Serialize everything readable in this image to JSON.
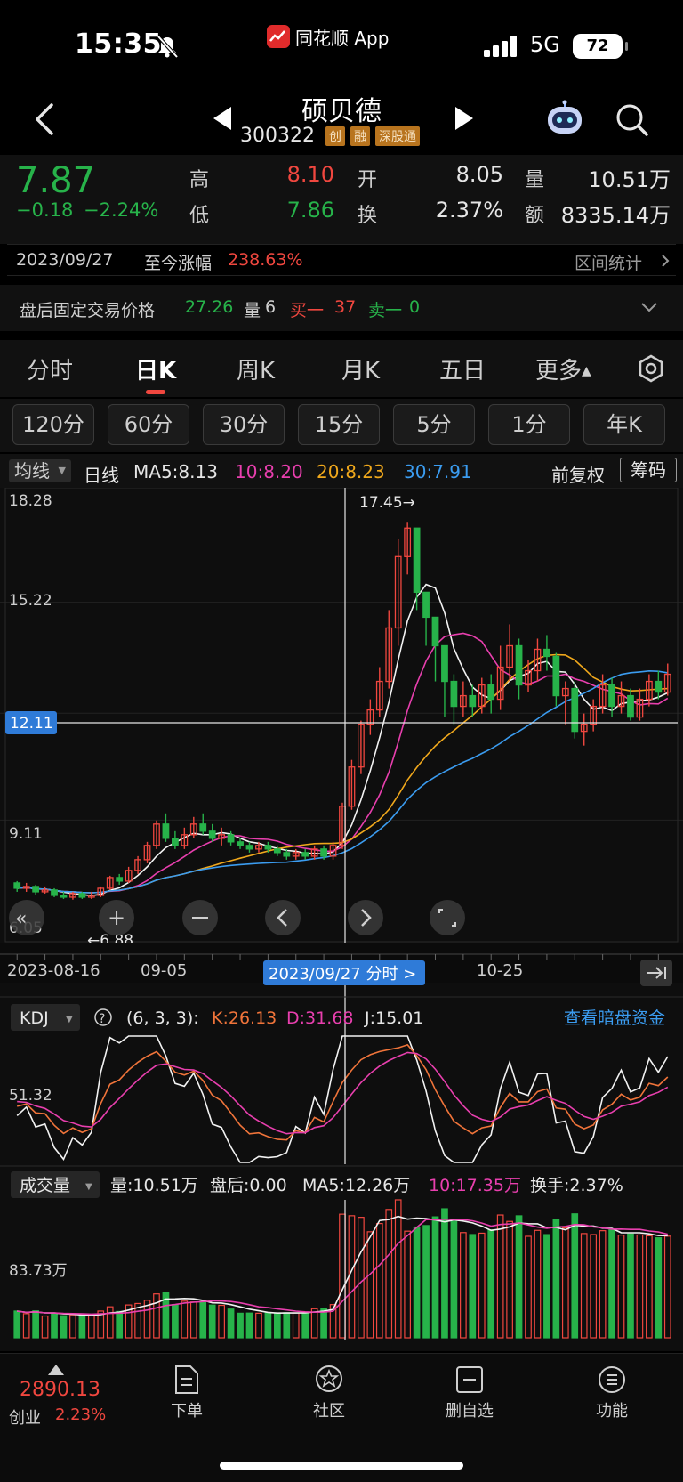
{
  "status_bar": {
    "time": "15:35",
    "app_name": "同花顺 App",
    "network": "5G",
    "battery": "72"
  },
  "header": {
    "stock_name": "硕贝德",
    "stock_code": "300322",
    "tags": [
      "创",
      "融",
      "深股通"
    ]
  },
  "quote": {
    "price": "7.87",
    "change": "−0.18",
    "change_pct": "−2.24%",
    "high_label": "高",
    "high": "8.10",
    "low_label": "低",
    "low": "7.86",
    "open_label": "开",
    "open": "8.05",
    "turnover_label": "换",
    "turnover": "2.37%",
    "volume_label": "量",
    "volume": "10.51万",
    "amount_label": "额",
    "amount": "8335.14万",
    "colors": {
      "up": "#f0473f",
      "down": "#27b34a"
    }
  },
  "range_stat": {
    "date": "2023/09/27",
    "label": "至今涨幅",
    "value": "238.63%",
    "link": "区间统计"
  },
  "after_hours": {
    "label": "盘后固定交易价格",
    "price": "27.26",
    "vol_label": "量",
    "vol": "6",
    "buy_label": "买一",
    "buy": "37",
    "sell_label": "卖一",
    "sell": "0"
  },
  "period_tabs": [
    "分时",
    "日K",
    "周K",
    "月K",
    "五日",
    "更多"
  ],
  "active_period": "日K",
  "minute_tabs": [
    "120分",
    "60分",
    "30分",
    "15分",
    "5分",
    "1分",
    "年K"
  ],
  "chart_header": {
    "indicator": "均线",
    "period": "日线",
    "ma5": "MA5:8.13",
    "ma10": "10:8.20",
    "ma20": "20:8.23",
    "ma30": "30:7.91",
    "adjust": "前复权",
    "chips": "筹码"
  },
  "chart_data": {
    "type": "candlestick",
    "y_ticks": [
      "18.28",
      "15.22",
      "9.11",
      "6.05"
    ],
    "crosshair_price": "12.11",
    "high_annotation": "17.45→",
    "low_annotation": "←6.88",
    "x_labels": [
      "2023-08-16",
      "09-05",
      "10-25"
    ],
    "selected_date": "2023/09/27 分时 >",
    "ylim": [
      6.05,
      18.28
    ],
    "candles": [
      [
        7.35,
        7.2,
        7.4,
        7.1
      ],
      [
        7.2,
        7.25,
        7.35,
        7.1
      ],
      [
        7.25,
        7.1,
        7.3,
        7.0
      ],
      [
        7.1,
        7.15,
        7.25,
        7.05
      ],
      [
        7.15,
        7.0,
        7.2,
        6.95
      ],
      [
        7.0,
        6.95,
        7.1,
        6.9
      ],
      [
        6.95,
        7.05,
        7.1,
        6.88
      ],
      [
        7.05,
        6.95,
        7.1,
        6.9
      ],
      [
        6.95,
        7.0,
        7.1,
        6.9
      ],
      [
        7.0,
        7.2,
        7.25,
        6.95
      ],
      [
        7.2,
        7.5,
        7.55,
        7.15
      ],
      [
        7.5,
        7.4,
        7.6,
        7.3
      ],
      [
        7.4,
        7.7,
        7.8,
        7.35
      ],
      [
        7.7,
        8.0,
        8.1,
        7.6
      ],
      [
        8.0,
        8.4,
        8.5,
        7.9
      ],
      [
        8.4,
        9.0,
        9.1,
        8.3
      ],
      [
        9.0,
        8.6,
        9.3,
        8.5
      ],
      [
        8.6,
        8.4,
        8.8,
        8.3
      ],
      [
        8.4,
        8.7,
        8.9,
        8.3
      ],
      [
        8.7,
        9.0,
        9.2,
        8.6
      ],
      [
        9.0,
        8.8,
        9.3,
        8.7
      ],
      [
        8.8,
        8.6,
        9.0,
        8.5
      ],
      [
        8.6,
        8.7,
        8.9,
        8.4
      ],
      [
        8.7,
        8.5,
        8.8,
        8.4
      ],
      [
        8.5,
        8.4,
        8.6,
        8.3
      ],
      [
        8.4,
        8.3,
        8.5,
        8.2
      ],
      [
        8.3,
        8.4,
        8.5,
        8.2
      ],
      [
        8.4,
        8.3,
        8.5,
        8.2
      ],
      [
        8.3,
        8.2,
        8.4,
        8.1
      ],
      [
        8.2,
        8.1,
        8.3,
        8.0
      ],
      [
        8.1,
        8.2,
        8.3,
        8.0
      ],
      [
        8.2,
        8.1,
        8.3,
        8.0
      ],
      [
        8.1,
        8.3,
        8.4,
        8.0
      ],
      [
        8.3,
        8.1,
        8.4,
        8.0
      ],
      [
        8.1,
        8.4,
        8.5,
        8.0
      ],
      [
        8.4,
        9.5,
        9.6,
        8.3
      ],
      [
        9.5,
        10.6,
        10.8,
        9.4
      ],
      [
        10.6,
        11.8,
        11.9,
        10.4
      ],
      [
        11.8,
        12.2,
        12.5,
        11.5
      ],
      [
        12.2,
        13.0,
        13.4,
        12.0
      ],
      [
        13.0,
        14.5,
        15.0,
        12.8
      ],
      [
        14.5,
        16.5,
        17.0,
        14.0
      ],
      [
        16.5,
        17.3,
        17.45,
        16.0
      ],
      [
        17.3,
        15.5,
        16.5,
        15.0
      ],
      [
        15.5,
        14.8,
        15.5,
        14.0
      ],
      [
        14.8,
        14.0,
        14.8,
        13.0
      ],
      [
        14.0,
        13.0,
        14.0,
        12.0
      ],
      [
        13.0,
        12.3,
        13.2,
        11.8
      ],
      [
        12.3,
        12.6,
        13.0,
        12.0
      ],
      [
        12.6,
        12.3,
        12.9,
        12.0
      ],
      [
        12.3,
        12.9,
        13.1,
        12.1
      ],
      [
        12.9,
        12.5,
        13.2,
        12.1
      ],
      [
        12.5,
        13.4,
        14.0,
        12.2
      ],
      [
        13.4,
        14.0,
        14.6,
        13.0
      ],
      [
        14.0,
        12.9,
        14.2,
        12.5
      ],
      [
        12.9,
        13.3,
        13.6,
        12.7
      ],
      [
        13.3,
        13.9,
        14.2,
        13.0
      ],
      [
        13.9,
        13.7,
        14.3,
        13.3
      ],
      [
        13.7,
        12.6,
        13.8,
        12.3
      ],
      [
        12.6,
        12.8,
        13.0,
        11.8
      ],
      [
        12.8,
        11.6,
        13.0,
        11.4
      ],
      [
        11.6,
        11.8,
        12.1,
        11.2
      ],
      [
        11.8,
        12.3,
        12.5,
        11.6
      ],
      [
        12.3,
        12.9,
        13.2,
        12.1
      ],
      [
        12.9,
        12.3,
        13.1,
        12.0
      ],
      [
        12.3,
        12.6,
        13.0,
        12.1
      ],
      [
        12.6,
        12.0,
        12.8,
        11.9
      ],
      [
        12.0,
        12.5,
        12.8,
        11.9
      ],
      [
        12.5,
        13.0,
        13.2,
        12.3
      ],
      [
        13.0,
        12.7,
        13.3,
        12.5
      ],
      [
        12.7,
        13.2,
        13.5,
        12.6
      ]
    ],
    "kdj": {
      "label": "KDJ",
      "params": "(6, 3, 3):",
      "k": "K:26.13",
      "d": "D:31.68",
      "j": "J:15.01",
      "y_tick": "51.32",
      "link": "查看暗盘资金"
    },
    "volume": {
      "label": "成交量",
      "vol": "量:10.51万",
      "after": "盘后:0.00",
      "ma5": "MA5:12.26万",
      "ma10": "10:17.35万",
      "turn": "换手:2.37%",
      "y_tick": "83.73万"
    }
  },
  "bottom_bar": {
    "index_value": "2890.13",
    "index_name": "创业",
    "index_pct": "2.23%",
    "items": [
      "下单",
      "社区",
      "删自选",
      "功能"
    ]
  }
}
